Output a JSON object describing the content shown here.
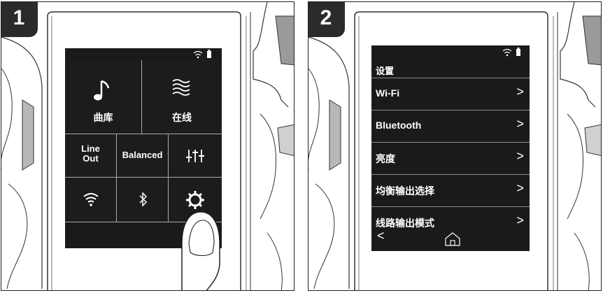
{
  "panel1": {
    "step": "1",
    "tiles": {
      "library_label": "曲库",
      "online_label": "在线",
      "lineout_line1": "Line",
      "lineout_line2": "Out",
      "balanced_label": "Balanced"
    },
    "icons": [
      "wifi-status-icon",
      "battery-icon",
      "music-note-icon",
      "online-waves-icon",
      "equalizer-icon",
      "wifi-icon",
      "bluetooth-icon",
      "settings-gear-icon"
    ]
  },
  "panel2": {
    "step": "2",
    "title": "设置",
    "items": [
      {
        "label": "Wi-Fi"
      },
      {
        "label": "Bluetooth"
      },
      {
        "label": "亮度"
      },
      {
        "label": "均衡输出选择"
      },
      {
        "label": "线路输出模式"
      }
    ],
    "chevron": ">",
    "back": "<",
    "icons": [
      "wifi-status-icon",
      "battery-icon",
      "chevron-right-icon",
      "back-arrow-icon",
      "home-icon"
    ]
  }
}
